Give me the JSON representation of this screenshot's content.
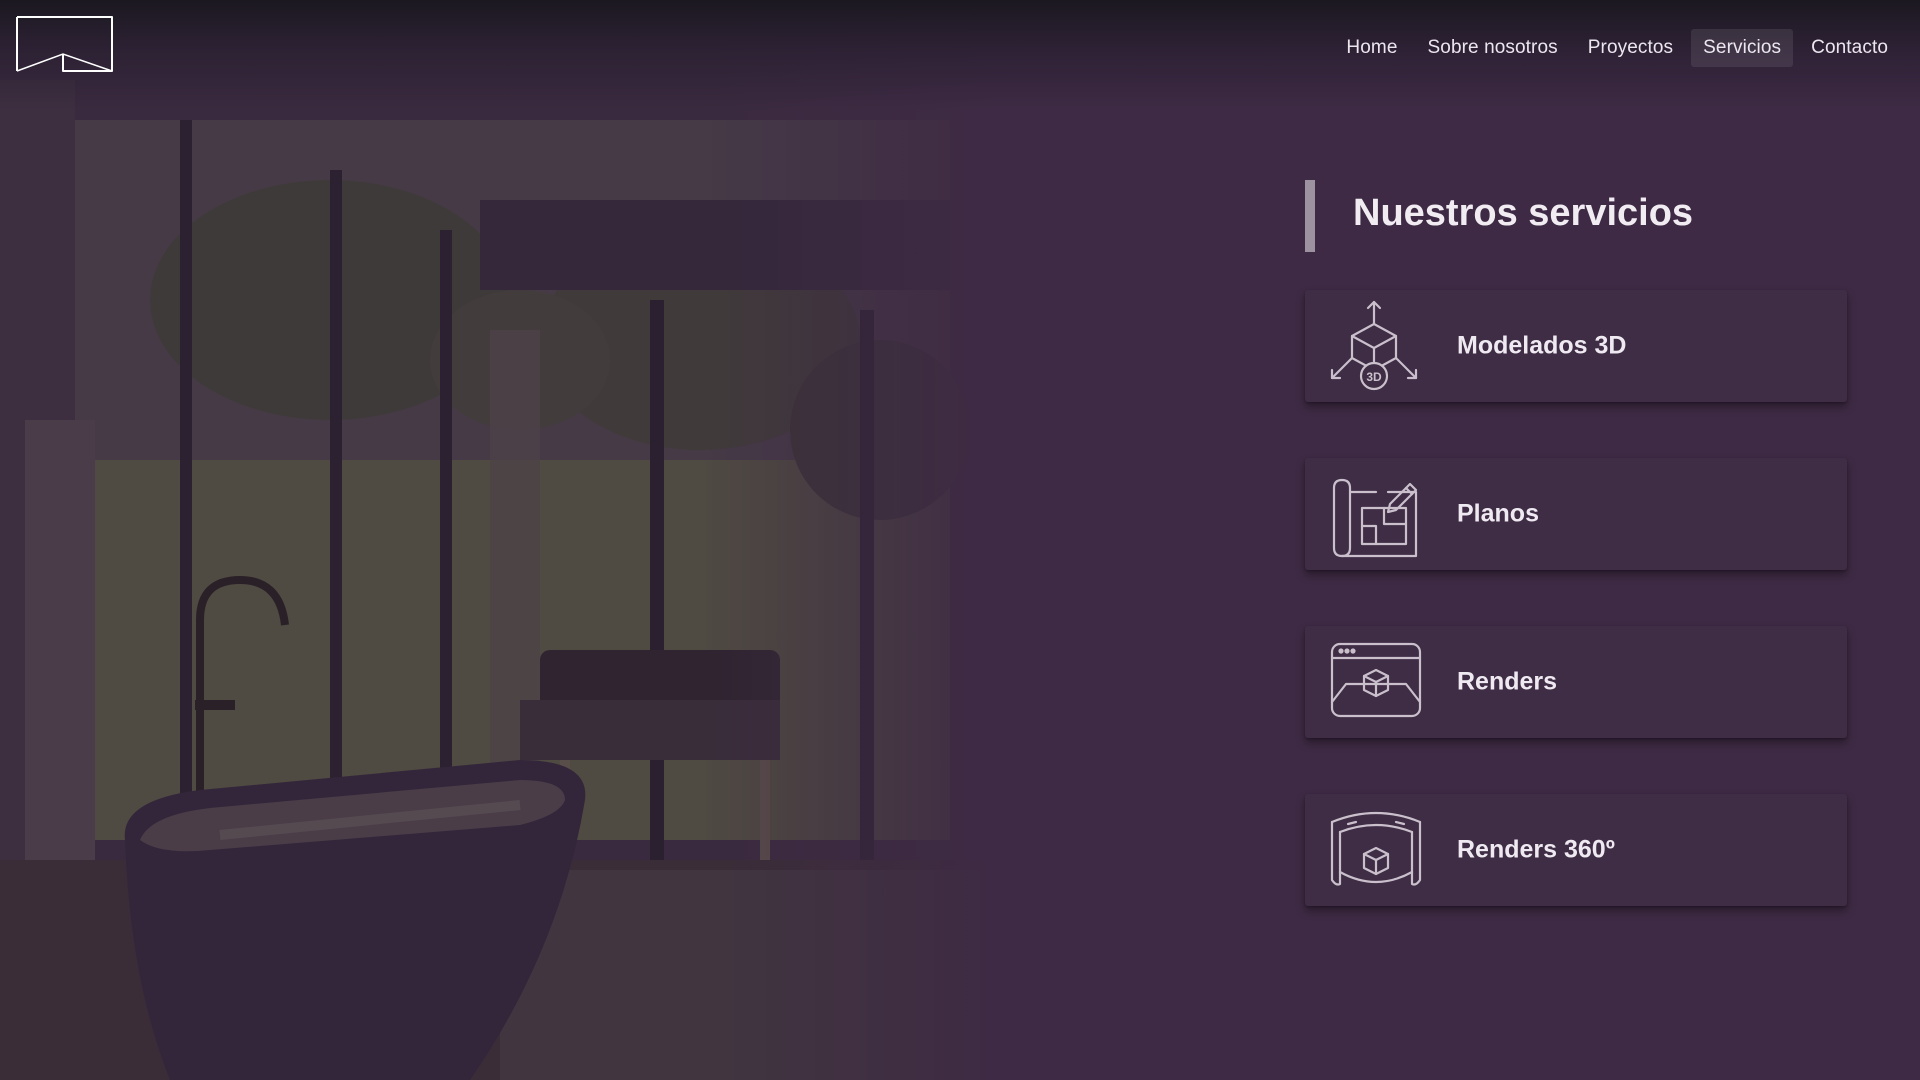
{
  "header": {
    "logo_icon": "studio-monogram-logo",
    "nav": [
      {
        "label": "Home",
        "active": false
      },
      {
        "label": "Sobre nosotros",
        "active": false
      },
      {
        "label": "Proyectos",
        "active": false
      },
      {
        "label": "Servicios",
        "active": true
      },
      {
        "label": "Contacto",
        "active": false
      }
    ]
  },
  "services": {
    "title": "Nuestros servicios",
    "items": [
      {
        "label": "Modelados 3D",
        "icon": "3d-modeling-icon",
        "icon_text": "3D"
      },
      {
        "label": "Planos",
        "icon": "blueprint-icon"
      },
      {
        "label": "Renders",
        "icon": "render-window-icon"
      },
      {
        "label": "Renders 360º",
        "icon": "panorama-360-icon"
      }
    ]
  },
  "colors": {
    "background": "#3e2a44",
    "card": "#3f2c45",
    "accent_bar": "#9d929f",
    "text": "#efeaf1"
  }
}
